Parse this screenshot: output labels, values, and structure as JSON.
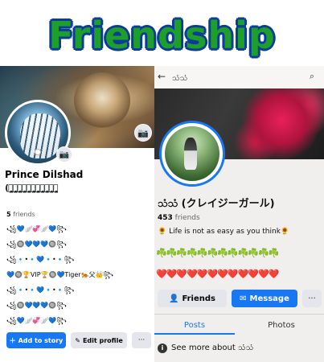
{
  "title": "Friendship",
  "left_profile": {
    "name": "Prince Dilshad",
    "name_decoration": "(ᰔ̤̥̮̮̮̮̥̤̮̤̮̥̤̮̮̤̥̥̮̤̤̤̥̥̥̤̤ᰔ̥̥̤̤̮̮̤̤̮̤̮̮̤̤̤̤̥̮̮̥̥̤̥̤̮̮ᰔ̮̥̥̤̮̮̤̮̤̥̥̤̥̤̤̮̤̮̤̮̮ᰔ̮̥̤̥̥̥̮̮̤̤̥̥̥̤̥̥̤̮̤̥̥̥ᰔ̮̮̤̤̮̤̤̮̥̤̤̥̤̤̮̤̮̤ᰔ̥̤̤̥̤̮̥̤̮̥̮̤̥̮̮̤̥̥̥ᰔ̥̤̤̤̤̤̥̮̥̤̮̥̥̮̤̥̥̮̮̮ᰔ̥̥̥̥̤̥̮̥̮̥̤̤̤̥̥̤̮̤̮̮̤ᰔ̮̥̥̥̤̥̤̥̤̤̥̤̤̤̮̤̥̥̮̥ᰔ̤̤̤̮̤̤̮̥̥̮̮̥̤̥̤̤̥̤̮̮̮ᰔ̤̮̥̥̥̤̥̮̤̤̤̤̤̮̥̤̥̤̮̥",
    "friends_count": "5",
    "friends_label": "friends",
    "bio_lines": [
      "꧁💙🪽💞🪽💙꧂",
      "꧁🔘💙💙💙🔘꧂",
      "꧁🔹•🔹💙🔹•🔹꧂",
      "💙🔘🏆VIP🏆🔘💙Tiger🐅父👑꧂",
      "꧁🔹•🔹💙🔹•🔹꧂",
      "꧁🔘💙💙💙🔘꧂",
      "꧁💙🪽💞🪽💙꧂"
    ],
    "add_story_label": "Add to story",
    "edit_profile_label": "Edit profile",
    "more_label": "···"
  },
  "right_profile": {
    "top_name": "သံသံ",
    "name": "သံသံ (クレイジーガール)",
    "friends_count": "453",
    "friends_label": "friends",
    "bio": "🌻 Life is not as easy as you think🌻",
    "emoji_row_1": "☘️☘️☘️☘️☘️☘️☘️☘️☘️☘️☘️☘️",
    "emoji_row_2": "❤️❤️❤️❤️❤️❤️❤️❤️❤️❤️❤️❤️",
    "friends_button": "Friends",
    "message_button": "Message",
    "more_label": "···",
    "tab_posts": "Posts",
    "tab_photos": "Photos",
    "see_more": "See more about သံသံ"
  },
  "colors": {
    "brand_blue": "#1877f2",
    "title_green": "#1e9e2a",
    "title_outline": "#0b3c9a"
  }
}
